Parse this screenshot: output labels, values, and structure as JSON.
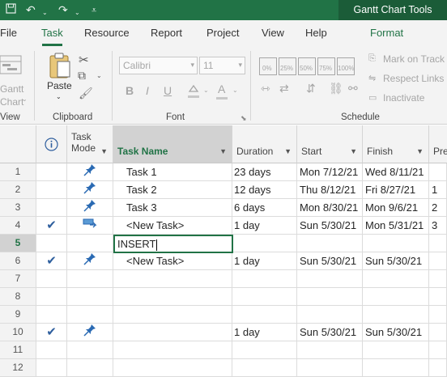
{
  "title_bar": {
    "context_tab_title": "Gantt Chart Tools"
  },
  "ribbon_tabs": [
    "File",
    "Task",
    "Resource",
    "Report",
    "Project",
    "View",
    "Help",
    "Format"
  ],
  "ribbon": {
    "view_group": {
      "button_label_1": "Gantt",
      "button_label_2": "Chart",
      "group_label": "View"
    },
    "clipboard_group": {
      "paste_label": "Paste",
      "group_label": "Clipboard"
    },
    "font_group": {
      "font_name": "Calibri",
      "font_size": "11",
      "bold": "B",
      "italic": "I",
      "underline": "U",
      "group_label": "Font"
    },
    "schedule_group": {
      "indicators": [
        "0%",
        "25%",
        "50%",
        "75%",
        "100%"
      ],
      "mark_on_track": "Mark on Track",
      "respect_links": "Respect Links",
      "inactivate": "Inactivate",
      "group_label": "Schedule"
    }
  },
  "grid": {
    "headers": {
      "task_mode_1": "Task",
      "task_mode_2": "Mode",
      "task_name": "Task Name",
      "duration": "Duration",
      "start": "Start",
      "finish": "Finish",
      "predecessors": "Pre"
    },
    "rows": [
      {
        "num": "1",
        "check": "",
        "mode": "auto-pin",
        "name": "Task 1",
        "duration": "23 days",
        "start": "Mon 7/12/21",
        "finish": "Wed 8/11/21",
        "pred": ""
      },
      {
        "num": "2",
        "check": "",
        "mode": "auto-pin",
        "name": "Task 2",
        "duration": "12 days",
        "start": "Thu 8/12/21",
        "finish": "Fri 8/27/21",
        "pred": "1"
      },
      {
        "num": "3",
        "check": "",
        "mode": "auto-pin",
        "name": "Task 3",
        "duration": "6 days",
        "start": "Mon 8/30/21",
        "finish": "Mon 9/6/21",
        "pred": "2"
      },
      {
        "num": "4",
        "check": "✔",
        "mode": "manual",
        "name": "<New Task>",
        "duration": "1 day",
        "start": "Sun 5/30/21",
        "finish": "Mon 5/31/21",
        "pred": "3"
      },
      {
        "num": "5",
        "check": "",
        "mode": "",
        "name": "",
        "duration": "",
        "start": "",
        "finish": "",
        "pred": ""
      },
      {
        "num": "6",
        "check": "✔",
        "mode": "auto-pin",
        "name": "<New Task>",
        "duration": "1 day",
        "start": "Sun 5/30/21",
        "finish": "Sun 5/30/21",
        "pred": ""
      },
      {
        "num": "7",
        "check": "",
        "mode": "",
        "name": "",
        "duration": "",
        "start": "",
        "finish": "",
        "pred": ""
      },
      {
        "num": "8",
        "check": "",
        "mode": "",
        "name": "",
        "duration": "",
        "start": "",
        "finish": "",
        "pred": ""
      },
      {
        "num": "9",
        "check": "",
        "mode": "",
        "name": "",
        "duration": "",
        "start": "",
        "finish": "",
        "pred": ""
      },
      {
        "num": "10",
        "check": "✔",
        "mode": "auto-pin",
        "name": "",
        "duration": "1 day",
        "start": "Sun 5/30/21",
        "finish": "Sun 5/30/21",
        "pred": ""
      },
      {
        "num": "11",
        "check": "",
        "mode": "",
        "name": "",
        "duration": "",
        "start": "",
        "finish": "",
        "pred": ""
      },
      {
        "num": "12",
        "check": "",
        "mode": "",
        "name": "",
        "duration": "",
        "start": "",
        "finish": "",
        "pred": ""
      }
    ],
    "edit_value": "INSERT"
  }
}
